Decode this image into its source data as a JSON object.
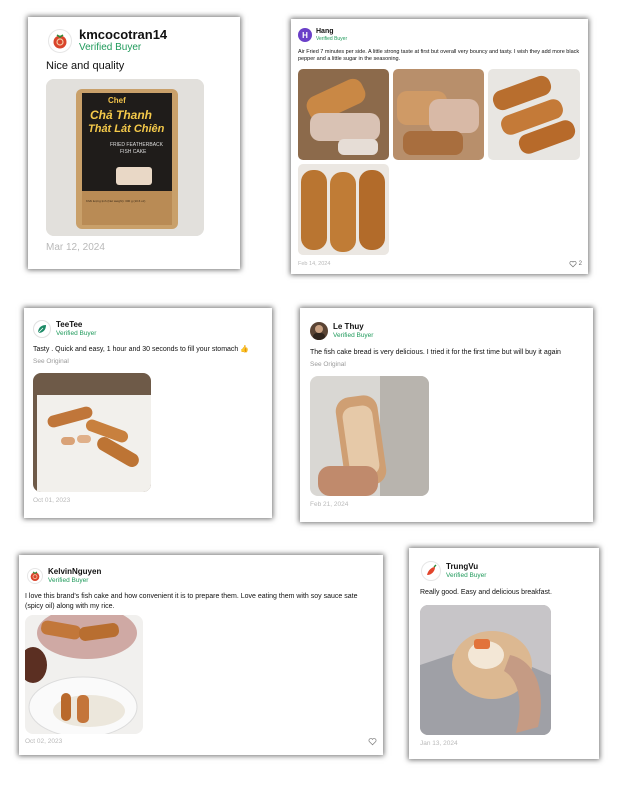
{
  "reviews": [
    {
      "user": "kmcocotran14",
      "badge": "Verified Buyer",
      "text": "Nice and quality",
      "date": "Mar 12, 2024",
      "package": {
        "brand": "Chef",
        "line1": "Chả Thanh",
        "line2": "Thát Lát Chiên",
        "sub1": "FRIED FEATHERBACK",
        "sub2": "FISH CAKE",
        "weight": "Khối lượng tịnh (Net weight): 300 g (10.6 oz)"
      }
    },
    {
      "user": "Hang",
      "avatar_letter": "H",
      "badge": "Verified Buyer",
      "text": "Air Fried 7 minutes per side. A little strong taste at first but overall very bouncy and tasty. I wish they add more black pepper and a little sugar in the seasoning.",
      "date": "Feb 14, 2024",
      "likes": "2"
    },
    {
      "user": "TeeTee",
      "badge": "Verified Buyer",
      "text": "Tasty . Quick and easy, 1 hour and 30 seconds to fill your stomach 👍",
      "see_original": "See Original",
      "date": "Oct 01, 2023"
    },
    {
      "user": "Le Thuy",
      "badge": "Verified Buyer",
      "text": "The fish cake bread is very delicious. I tried it for the first time but will buy it again",
      "see_original": "See Original",
      "date": "Feb 21, 2024"
    },
    {
      "user": "KelvinNguyen",
      "badge": "Verified Buyer",
      "text": "I love this brand's fish cake and how convenient it is to prepare them. Love eating them with soy sauce sate (spicy oil) along with my rice.",
      "date": "Oct 02, 2023"
    },
    {
      "user": "TrungVu",
      "badge": "Verified Buyer",
      "text": "Really good. Easy and delicious breakfast.",
      "date": "Jan 13, 2024"
    }
  ],
  "colors": {
    "verified": "#1f9a5b",
    "date": "#b9b9b9",
    "accent_purple": "#6a3fc8"
  },
  "icons": [
    "tomato-avatar-icon",
    "leaf-avatar-icon",
    "heart-icon",
    "chili-avatar-icon"
  ]
}
